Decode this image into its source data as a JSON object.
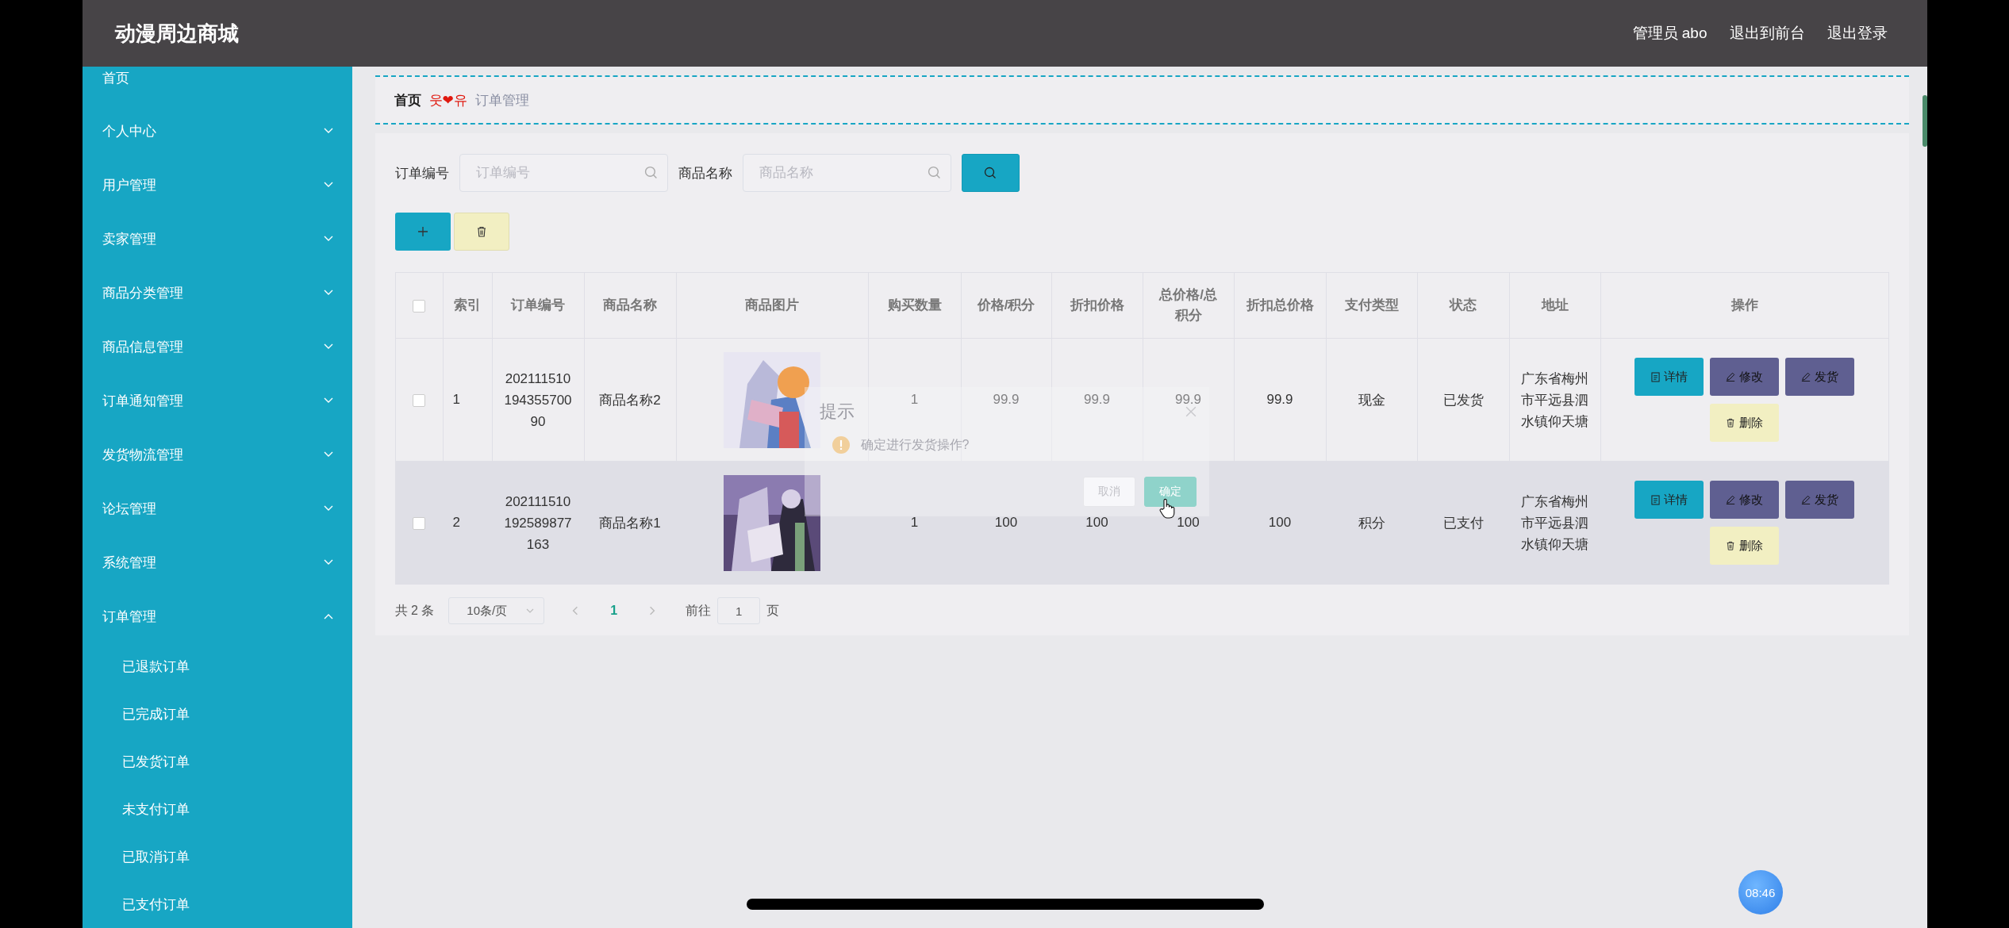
{
  "header": {
    "title": "动漫周边商城",
    "user": "管理员 abo",
    "links": [
      "退出到前台",
      "退出登录"
    ]
  },
  "sidebar": {
    "items": [
      {
        "label": "首页",
        "kind": "link"
      },
      {
        "label": "个人中心",
        "kind": "menu",
        "expanded": false
      },
      {
        "label": "用户管理",
        "kind": "menu",
        "expanded": false
      },
      {
        "label": "卖家管理",
        "kind": "menu",
        "expanded": false
      },
      {
        "label": "商品分类管理",
        "kind": "menu",
        "expanded": false
      },
      {
        "label": "商品信息管理",
        "kind": "menu",
        "expanded": false
      },
      {
        "label": "订单通知管理",
        "kind": "menu",
        "expanded": false
      },
      {
        "label": "发货物流管理",
        "kind": "menu",
        "expanded": false
      },
      {
        "label": "论坛管理",
        "kind": "menu",
        "expanded": false
      },
      {
        "label": "系统管理",
        "kind": "menu",
        "expanded": false
      },
      {
        "label": "订单管理",
        "kind": "menu",
        "expanded": true,
        "children": [
          {
            "label": "已退款订单"
          },
          {
            "label": "已完成订单"
          },
          {
            "label": "已发货订单"
          },
          {
            "label": "未支付订单"
          },
          {
            "label": "已取消订单"
          },
          {
            "label": "已支付订单"
          }
        ]
      }
    ]
  },
  "breadcrumb": {
    "home": "首页",
    "separator": "웃❤유",
    "current": "订单管理"
  },
  "search": {
    "fields": [
      {
        "label": "订单编号",
        "placeholder": "订单编号"
      },
      {
        "label": "商品名称",
        "placeholder": "商品名称"
      }
    ]
  },
  "table": {
    "select_all_checked": false,
    "columns": [
      "索引",
      "订单编号",
      "商品名称",
      "商品图片",
      "购买数量",
      "价格/积分",
      "折扣价格",
      "总价格/总积分",
      "折扣总价格",
      "支付类型",
      "状态",
      "地址",
      "操作"
    ],
    "rows": [
      {
        "checked": false,
        "highlighted": false,
        "index": "1",
        "order_no": "20211151019435570090",
        "product": "商品名称2",
        "quantity": "1",
        "price": "99.9",
        "discount_price": "99.9",
        "total": "99.9",
        "discount_total": "99.9",
        "payment": "现金",
        "status": "已发货",
        "address": "广东省梅州市平远县泗水镇仰天塘",
        "actions": [
          {
            "label": "详情",
            "kind": "detail"
          },
          {
            "label": "修改",
            "kind": "edit"
          },
          {
            "label": "发货",
            "kind": "ship"
          },
          {
            "label": "删除",
            "kind": "delete"
          }
        ]
      },
      {
        "checked": false,
        "highlighted": true,
        "index": "2",
        "order_no": "202111510192589877163",
        "product": "商品名称1",
        "quantity": "1",
        "price": "100",
        "discount_price": "100",
        "total": "100",
        "discount_total": "100",
        "payment": "积分",
        "status": "已支付",
        "address": "广东省梅州市平远县泗水镇仰天塘",
        "actions": [
          {
            "label": "详情",
            "kind": "detail"
          },
          {
            "label": "修改",
            "kind": "edit"
          },
          {
            "label": "发货",
            "kind": "ship"
          },
          {
            "label": "删除",
            "kind": "delete"
          }
        ]
      }
    ]
  },
  "pagination": {
    "total": "共 2 条",
    "page_size": "10条/页",
    "current_page": "1",
    "goto_label": "前往",
    "goto_value": "1",
    "page_suffix": "页"
  },
  "dialog": {
    "title": "提示",
    "message": "确定进行发货操作?",
    "buttons": [
      {
        "label": "取消",
        "kind": "cancel"
      },
      {
        "label": "确定",
        "kind": "confirm"
      }
    ]
  },
  "overlay_clock": "08:46"
}
